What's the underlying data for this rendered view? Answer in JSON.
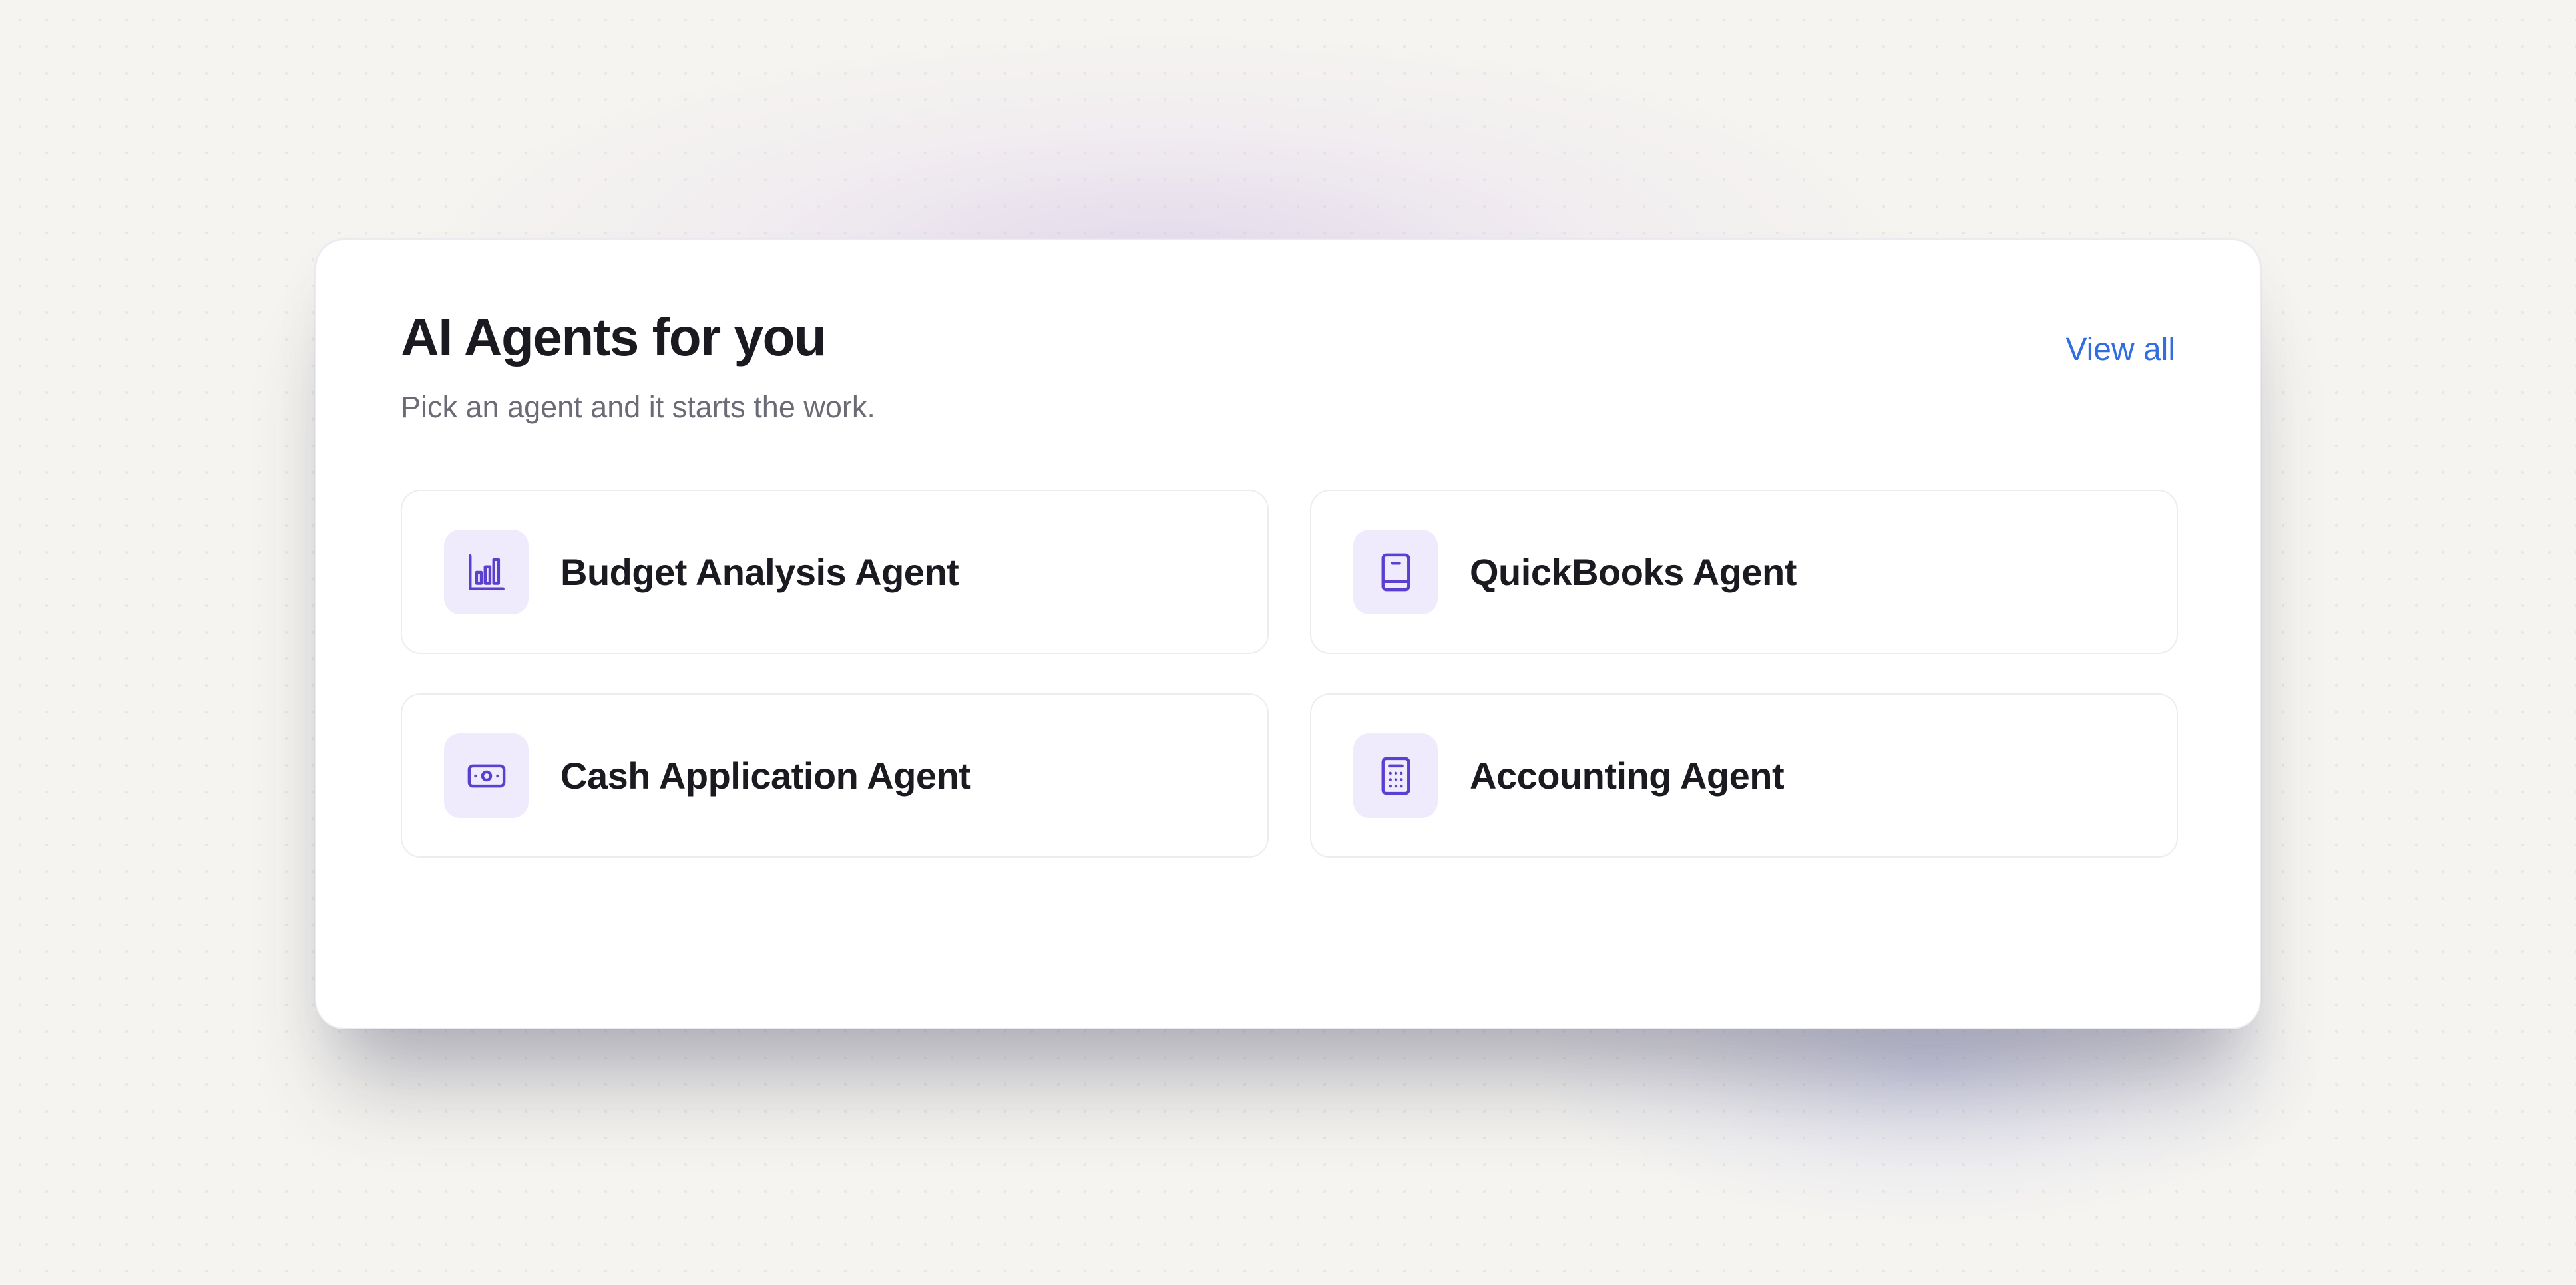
{
  "panel": {
    "title": "AI Agents for you",
    "subtitle": "Pick an agent and it starts the work.",
    "view_all_label": "View all"
  },
  "agents": [
    {
      "label": "Budget Analysis Agent",
      "icon": "bar-chart-icon"
    },
    {
      "label": "QuickBooks Agent",
      "icon": "book-icon"
    },
    {
      "label": "Cash Application Agent",
      "icon": "banknote-icon"
    },
    {
      "label": "Accounting Agent",
      "icon": "calculator-icon"
    }
  ],
  "colors": {
    "background": "#f5f4f0",
    "card": "#ffffff",
    "title_text": "#1b1a20",
    "subtitle_text": "#6b6b76",
    "link": "#2f6de1",
    "icon_tile": "#efebfc",
    "icon_stroke": "#5b3fd0"
  }
}
